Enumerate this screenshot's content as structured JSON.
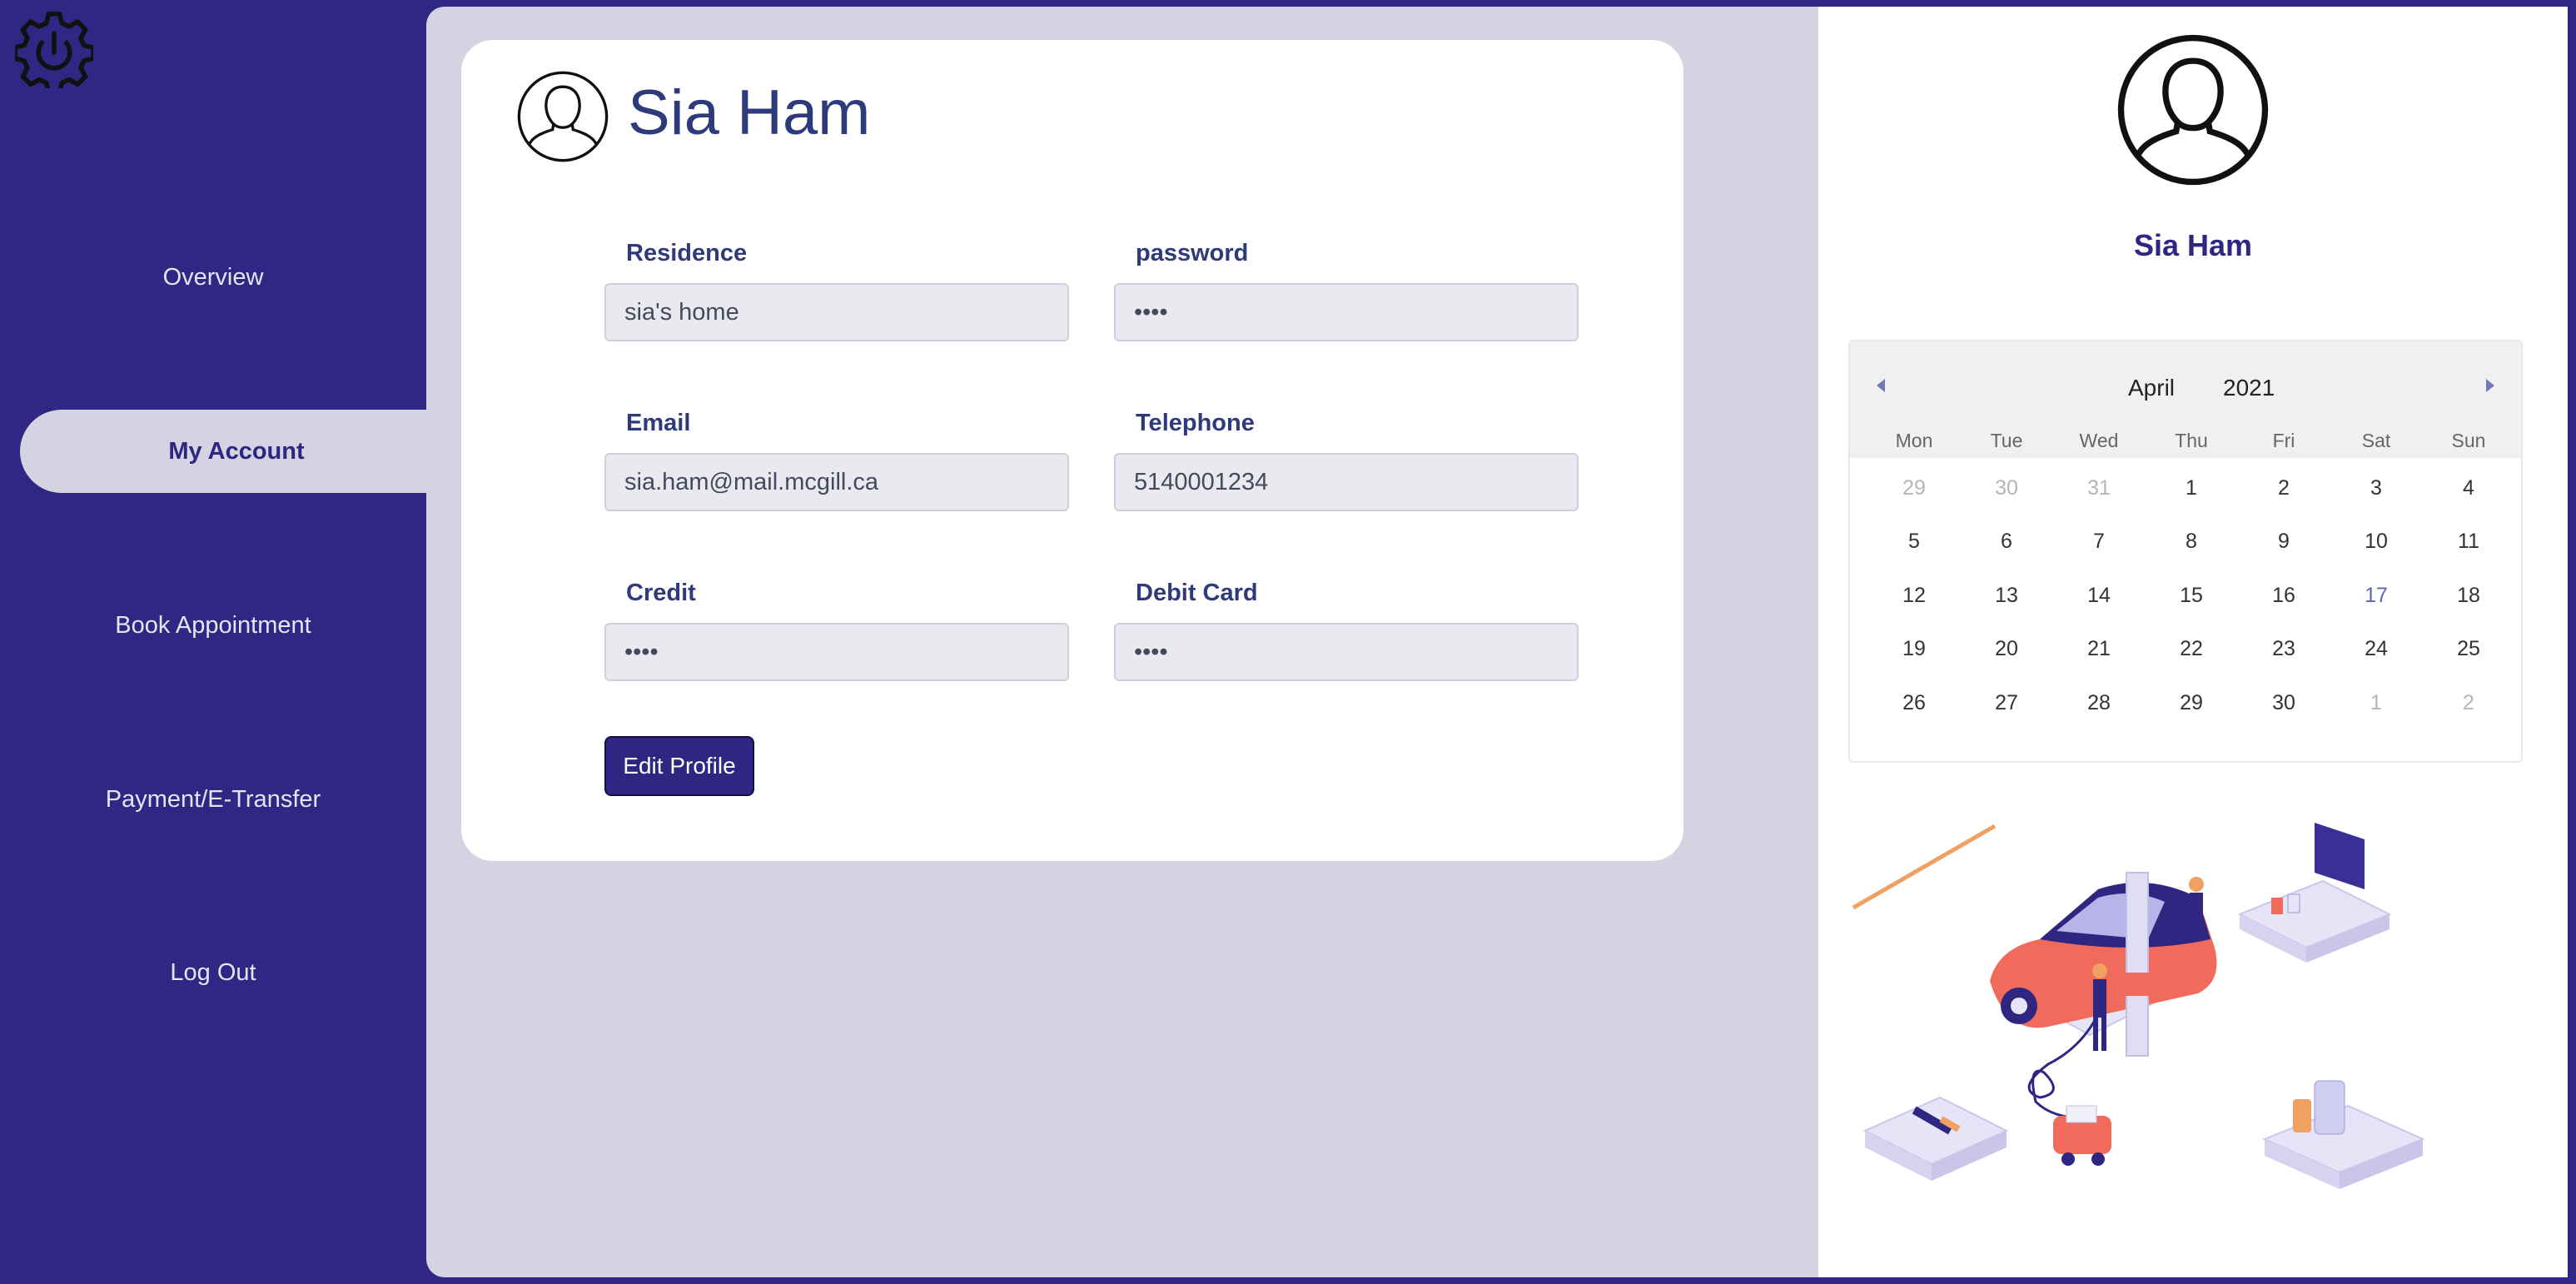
{
  "sidebar": {
    "items": [
      {
        "label": "Overview"
      },
      {
        "label": "My Account"
      },
      {
        "label": "Book Appointment"
      },
      {
        "label": "Payment/E-Transfer"
      },
      {
        "label": "Log Out"
      }
    ],
    "logo_icon": "gear-power-icon"
  },
  "profile_card": {
    "name": "Sia Ham",
    "avatar_icon": "user-avatar-icon",
    "fields": {
      "residence": {
        "label": "Residence",
        "value": "sia's home"
      },
      "password": {
        "label": "password",
        "value": "••••"
      },
      "email": {
        "label": "Email",
        "value": "sia.ham@mail.mcgill.ca"
      },
      "telephone": {
        "label": "Telephone",
        "value": "5140001234"
      },
      "credit": {
        "label": "Credit",
        "value": "••••"
      },
      "debit_card": {
        "label": "Debit Card",
        "value": "••••"
      }
    },
    "edit_button": "Edit Profile"
  },
  "right_panel": {
    "name": "Sia Ham",
    "avatar_icon": "user-avatar-icon",
    "calendar": {
      "month": "April",
      "year": "2021",
      "weekdays": [
        "Mon",
        "Tue",
        "Wed",
        "Thu",
        "Fri",
        "Sat",
        "Sun"
      ],
      "weeks": [
        [
          "29",
          "30",
          "31",
          "1",
          "2",
          "3",
          "4"
        ],
        [
          "5",
          "6",
          "7",
          "8",
          "9",
          "10",
          "11"
        ],
        [
          "12",
          "13",
          "14",
          "15",
          "16",
          "17",
          "18"
        ],
        [
          "19",
          "20",
          "21",
          "22",
          "23",
          "24",
          "25"
        ],
        [
          "26",
          "27",
          "28",
          "29",
          "30",
          "1",
          "2"
        ]
      ],
      "today": "17"
    },
    "illustration": "car-repair-illustration"
  },
  "colors": {
    "brand": "#302684",
    "main_bg": "#d5d3e2",
    "label_text": "#2e3a7a",
    "today_text": "#5b67b2"
  }
}
